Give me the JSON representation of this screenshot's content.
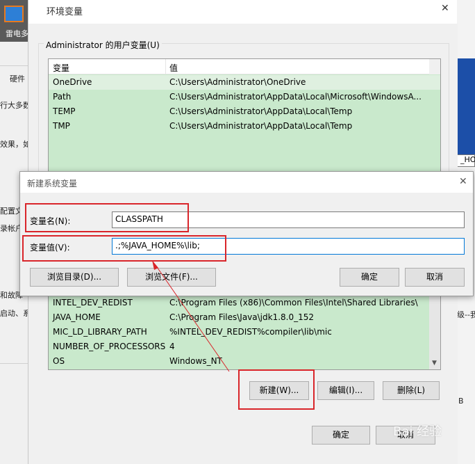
{
  "background": {
    "app_label": "雷电多",
    "fragments": [
      "硬件",
      "行大多数",
      "效果，如",
      "配置文",
      "录帐户",
      "和故障",
      "启动、系"
    ],
    "right_box": "_HO",
    "right_frag1": "级--我",
    "right_frag2": "B"
  },
  "env_dialog": {
    "title": "环境变量",
    "user_group_label": "Administrator 的用户变量(U)",
    "user_vars": {
      "col_var": "变量",
      "col_val": "值",
      "rows": [
        {
          "name": "OneDrive",
          "value": "C:\\Users\\Administrator\\OneDrive"
        },
        {
          "name": "Path",
          "value": "C:\\Users\\Administrator\\AppData\\Local\\Microsoft\\WindowsA..."
        },
        {
          "name": "TEMP",
          "value": "C:\\Users\\Administrator\\AppData\\Local\\Temp"
        },
        {
          "name": "TMP",
          "value": "C:\\Users\\Administrator\\AppData\\Local\\Temp"
        }
      ]
    },
    "system_vars": {
      "rows": [
        {
          "name": "INTEL_DEV_REDIST",
          "value": "C:\\Program Files (x86)\\Common Files\\Intel\\Shared Libraries\\"
        },
        {
          "name": "JAVA_HOME",
          "value": "C:\\Program Files\\Java\\jdk1.8.0_152"
        },
        {
          "name": "MIC_LD_LIBRARY_PATH",
          "value": "%INTEL_DEV_REDIST%compiler\\lib\\mic"
        },
        {
          "name": "NUMBER_OF_PROCESSORS",
          "value": "4"
        },
        {
          "name": "OS",
          "value": "Windows_NT"
        }
      ]
    },
    "buttons": {
      "new": "新建(W)...",
      "edit": "编辑(I)...",
      "delete": "删除(L)",
      "ok": "确定",
      "cancel": "取消"
    }
  },
  "new_dialog": {
    "title": "新建系统变量",
    "name_label": "变量名(N):",
    "name_value": "CLASSPATH",
    "value_label": "变量值(V):",
    "value_value": ".;%JAVA_HOME%\\lib;",
    "buttons": {
      "browse_dir": "浏览目录(D)...",
      "browse_file": "浏览文件(F)...",
      "ok": "确定",
      "cancel": "取消"
    }
  },
  "watermark": "Bai 经验",
  "colors": {
    "highlight_red": "#d9252a",
    "list_green": "#c9e9cc",
    "focus_blue": "#0078d7"
  }
}
